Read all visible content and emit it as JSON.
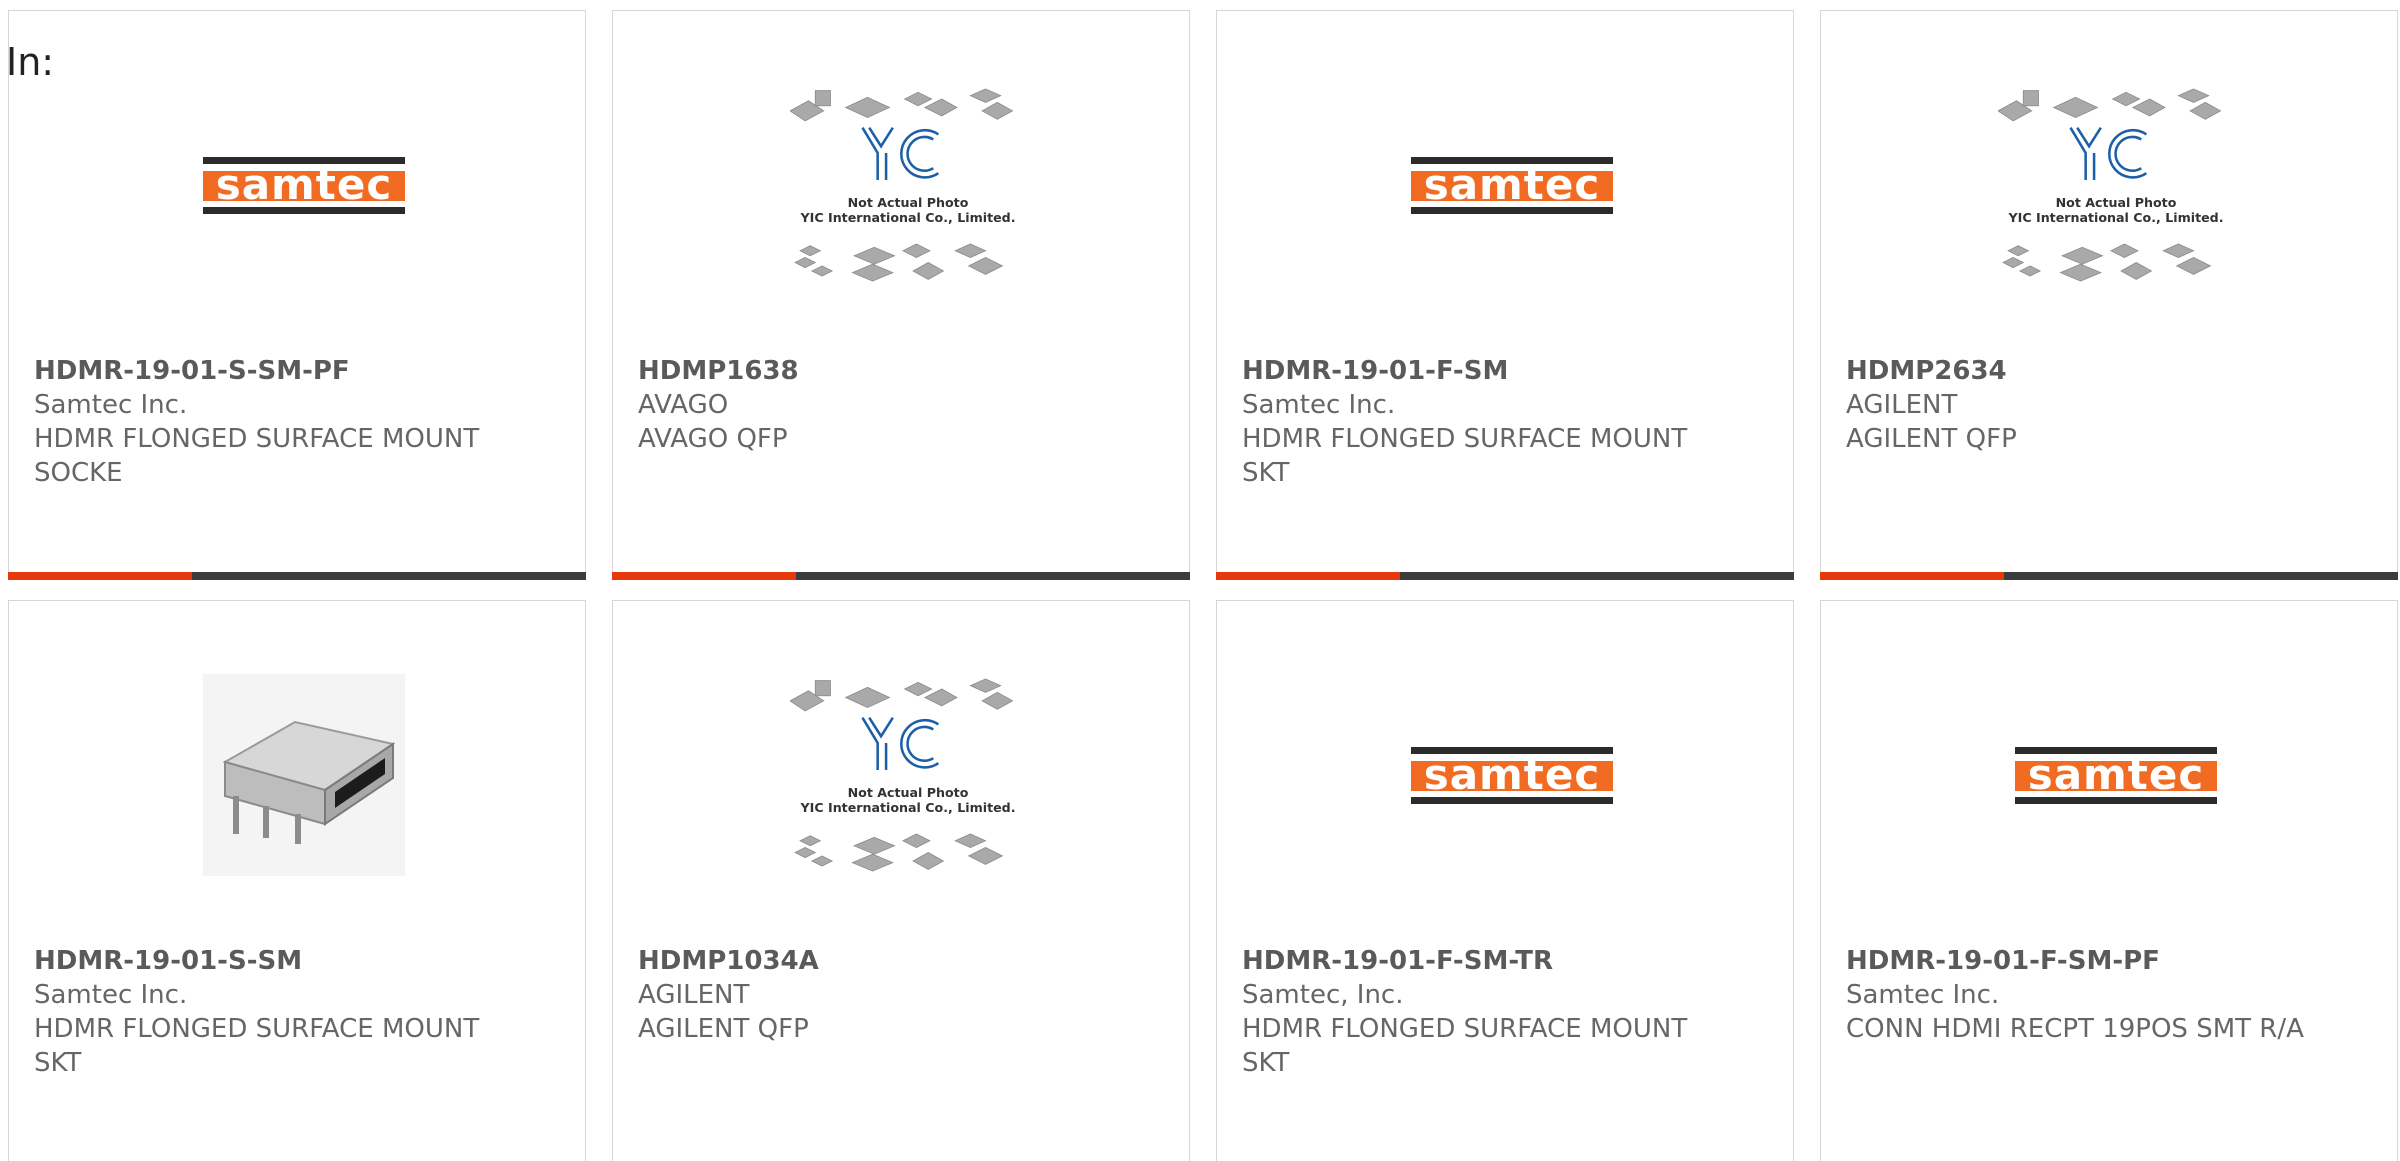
{
  "header": {
    "in_label": "In:"
  },
  "colors": {
    "accent": "#e8380d",
    "bar": "#3c3c3c",
    "text": "#666666",
    "samtec_orange": "#f26b22",
    "yic_blue": "#1a5fa8"
  },
  "placeholder_image": {
    "line1": "Not Actual Photo",
    "line2": "YIC International Co., Limited.",
    "logo": "YIC"
  },
  "samtec_logo_text": "samtec",
  "products": [
    {
      "part": "HDMR-19-01-S-SM-PF",
      "maker": "Samtec Inc.",
      "desc": "HDMR FLONGED SURFACE MOUNT SOCKE",
      "image": "samtec-logo"
    },
    {
      "part": "HDMP1638",
      "maker": "AVAGO",
      "desc": "AVAGO QFP",
      "image": "yic-placeholder"
    },
    {
      "part": "HDMR-19-01-F-SM",
      "maker": "Samtec Inc.",
      "desc": "HDMR FLONGED SURFACE MOUNT SKT",
      "image": "samtec-logo"
    },
    {
      "part": "HDMP2634",
      "maker": "AGILENT",
      "desc": "AGILENT QFP",
      "image": "yic-placeholder"
    },
    {
      "part": "HDMR-19-01-S-SM",
      "maker": "Samtec Inc.",
      "desc": "HDMR FLONGED SURFACE MOUNT SKT",
      "image": "hdmi-connector-photo"
    },
    {
      "part": "HDMP1034A",
      "maker": "AGILENT",
      "desc": "AGILENT QFP",
      "image": "yic-placeholder"
    },
    {
      "part": "HDMR-19-01-F-SM-TR",
      "maker": "Samtec, Inc.",
      "desc": "HDMR FLONGED SURFACE MOUNT SKT",
      "image": "samtec-logo"
    },
    {
      "part": "HDMR-19-01-F-SM-PF",
      "maker": "Samtec Inc.",
      "desc": "CONN HDMI RECPT 19POS SMT R/A",
      "image": "samtec-logo"
    }
  ]
}
